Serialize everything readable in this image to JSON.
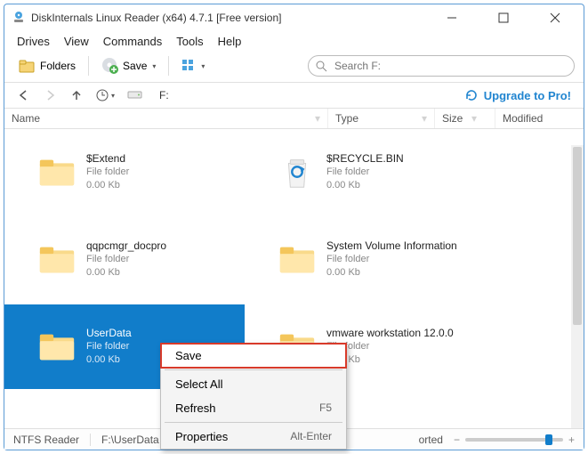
{
  "window": {
    "title": "DiskInternals Linux Reader (x64) 4.7.1 [Free version]"
  },
  "menu": {
    "items": [
      "Drives",
      "View",
      "Commands",
      "Tools",
      "Help"
    ]
  },
  "toolbar": {
    "folders": "Folders",
    "save": "Save"
  },
  "search": {
    "placeholder": "Search F:"
  },
  "nav": {
    "path": "F:"
  },
  "upgrade": {
    "label": "Upgrade to Pro!"
  },
  "columns": {
    "name": "Name",
    "type": "Type",
    "size": "Size",
    "modified": "Modified"
  },
  "items": [
    {
      "name": "$Extend",
      "type": "File folder",
      "size": "0.00 Kb",
      "icon": "folder"
    },
    {
      "name": "$RECYCLE.BIN",
      "type": "File folder",
      "size": "0.00 Kb",
      "icon": "recycle"
    },
    {
      "name": "qqpcmgr_docpro",
      "type": "File folder",
      "size": "0.00 Kb",
      "icon": "folder"
    },
    {
      "name": "System Volume Information",
      "type": "File folder",
      "size": "0.00 Kb",
      "icon": "folder"
    },
    {
      "name": "UserData",
      "type": "File folder",
      "size": "0.00 Kb",
      "icon": "folder",
      "selected": true
    },
    {
      "name": "vmware workstation 12.0.0",
      "type": "File folder",
      "size": "0.00 Kb",
      "icon": "folder"
    }
  ],
  "ctx": {
    "save": "Save",
    "selectAll": "Select All",
    "refresh": "Refresh",
    "refreshKey": "F5",
    "properties": "Properties",
    "propertiesKey": "Alt-Enter"
  },
  "status": {
    "reader": "NTFS Reader",
    "path": "F:\\UserData",
    "sort": "orted"
  }
}
